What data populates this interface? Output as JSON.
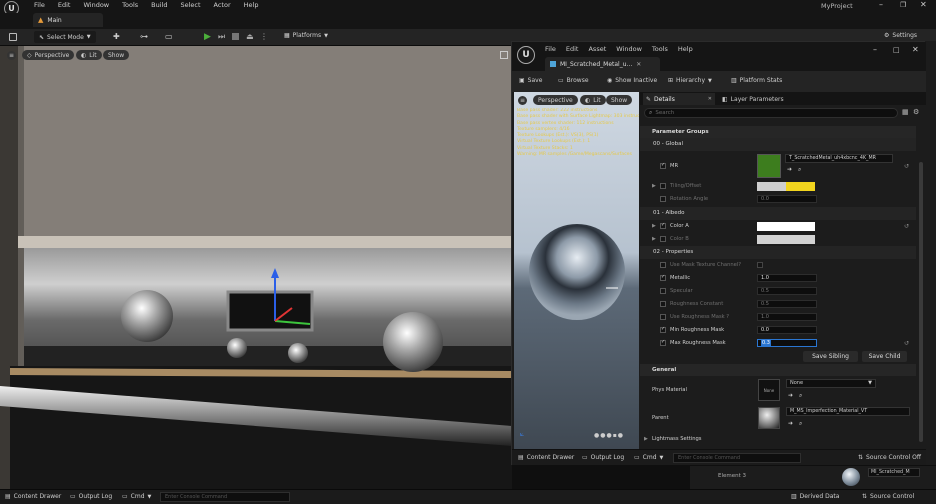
{
  "app": {
    "project_name": "MyProject",
    "menu": [
      "File",
      "Edit",
      "Window",
      "Tools",
      "Build",
      "Select",
      "Actor",
      "Help"
    ],
    "level_tab": "Main"
  },
  "toolbar": {
    "select_mode": "Select Mode",
    "platforms": "Platforms",
    "settings": "Settings"
  },
  "viewport": {
    "perspective": "Perspective",
    "lit": "Lit",
    "show": "Show"
  },
  "status_bar": {
    "content_drawer": "Content Drawer",
    "output_log": "Output Log",
    "cmd": "Cmd",
    "console_placeholder": "Enter Console Command",
    "derived_data": "Derived Data",
    "source_control": "Source Control"
  },
  "material_editor": {
    "menu": [
      "File",
      "Edit",
      "Asset",
      "Window",
      "Tools",
      "Help"
    ],
    "tab_title": "MI_Scratched_Metal_u...",
    "toolbar": {
      "save": "Save",
      "browse": "Browse",
      "show_inactive": "Show Inactive",
      "hierarchy": "Hierarchy",
      "platform_stats": "Platform Stats"
    },
    "preview": {
      "perspective": "Perspective",
      "lit": "Lit",
      "show": "Show",
      "stats": [
        "Base pass shader: 222 instructions",
        "Base pass shader with Surface Lightmap: 303 instructions",
        "Base pass vertex shader: 112 instructions",
        "Texture samplers: 4/16",
        "Texture Lookups (Est.): VS(3), PS(1)",
        "Virtual Texture Lookups (Est.): 1",
        "Virtual Texture Stacks: 1",
        "Warning: MR samples /Game/Megascans/Surfaces"
      ]
    },
    "details": {
      "tab_details": "Details",
      "tab_layer_parameters": "Layer Parameters",
      "search_placeholder": "Search",
      "parameter_groups": "Parameter Groups",
      "group_global": "00 - Global",
      "mr_label": "MR",
      "mr_texture": "T_ScratchedMetal_uh4xbcnc_4K_MR",
      "tiling_offset": "Tiling/Offset",
      "rotation_angle": "Rotation Angle",
      "rotation_value": "0.0",
      "group_albedo": "01 - Albedo",
      "color_a": "Color A",
      "color_b": "Color B",
      "group_properties": "02 - Properties",
      "use_mask_texture": "Use Mask Texture Channel?",
      "metallic": "Metallic",
      "metallic_value": "1.0",
      "specular": "Specular",
      "specular_value": "0.5",
      "roughness_constant": "Roughness Constant",
      "roughness_constant_value": "0.5",
      "use_roughness_mask": "Use Roughness Mask ?",
      "use_roughness_mask_value": "1.0",
      "min_roughness_mask": "Min Roughness Mask",
      "min_roughness_value": "0.0",
      "max_roughness_mask": "Max Roughness Mask",
      "max_roughness_value": "0.3",
      "save_sibling": "Save Sibling",
      "save_child": "Save Child",
      "general": "General",
      "phys_material": "Phys Material",
      "phys_value": "None",
      "phys_thumb": "None",
      "parent": "Parent",
      "parent_value": "M_MS_Imperfection_Material_VT",
      "lightmass": "Lightmass Settings"
    },
    "bottom": {
      "content_drawer": "Content Drawer",
      "output_log": "Output Log",
      "cmd": "Cmd",
      "console_placeholder": "Enter Console Command",
      "source_control": "Source Control Off"
    }
  },
  "background_panel": {
    "element": "Element 3",
    "asset_name": "MI_Scratched_M"
  },
  "colors": {
    "accent_blue": "#2a76d2",
    "play_green": "#4caf3b",
    "texture_green": "#3d7d1e",
    "yellow": "#f2d51e"
  }
}
